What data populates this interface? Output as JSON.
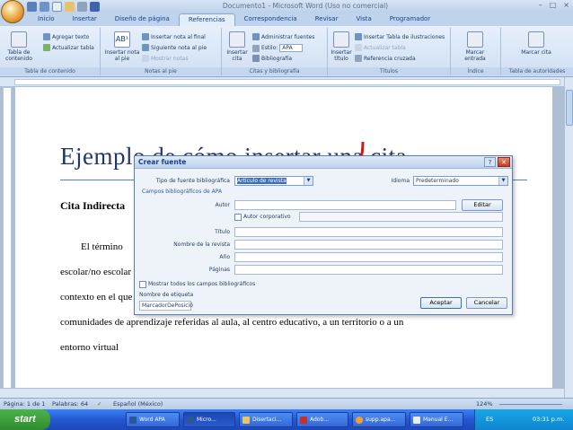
{
  "window": {
    "title": "Documento1 - Microsoft Word (Uso no comercial)",
    "controls": [
      "–",
      "□",
      "×"
    ]
  },
  "tabs": [
    "Inicio",
    "Insertar",
    "Diseño de página",
    "Referencias",
    "Correspondencia",
    "Revisar",
    "Vista",
    "Programador"
  ],
  "ribbon": {
    "toc": {
      "add_text": "Agregar texto",
      "update_table": "Actualizar tabla",
      "big": "Tabla de contenido",
      "group": "Tabla de contenido"
    },
    "footnotes": {
      "insert_endnote": "Insertar nota al final",
      "next_footnote": "Siguiente nota al pie",
      "show_notes": "Mostrar notas",
      "big": "Insertar nota al pie",
      "group": "Notas al pie"
    },
    "citations": {
      "manage_sources": "Administrar fuentes",
      "style_label": "Estilo:",
      "style_value": "APA",
      "bibliography": "Bibliografía",
      "big": "Insertar cita",
      "group": "Citas y bibliografía"
    },
    "captions": {
      "insert_illustrations": "Insertar Tabla de ilustraciones",
      "update_table": "Actualizar tabla",
      "cross_reference": "Referencia cruzada",
      "big": "Insertar título",
      "group": "Títulos"
    },
    "index": {
      "big": "Marcar entrada",
      "group": "Índice"
    },
    "authorities": {
      "big": "Marcar cita",
      "group": "Tabla de autoridades"
    }
  },
  "document": {
    "title": "Ejemplo de cómo insertar una cita",
    "heading": "Cita Indirecta",
    "lines": [
      "El término",
      "escolar/no escolar",
      "contexto en el que",
      "comunidades de aprendizaje referidas al aula, al centro educativo, a un territorio o a un",
      "entorno virtual"
    ]
  },
  "dialog": {
    "title": "Crear fuente",
    "help": "?",
    "close": "✕",
    "source_type_label": "Tipo de fuente bibliográfica",
    "source_type_value": "Artículo de revista",
    "language_label": "Idioma",
    "language_value": "Predeterminado",
    "apa_fields_label": "Campos bibliográficos de APA",
    "author_label": "Autor",
    "edit_button": "Editar",
    "corporate_author_label": "Autor corporativo",
    "fields": [
      "Título",
      "Nombre de la revista",
      "Año",
      "Páginas"
    ],
    "show_all_label": "Mostrar todos los campos bibliográficos",
    "tag_name_label": "Nombre de etiqueta",
    "tag_name_value": "MarcadorDePosició",
    "ok_button": "Aceptar",
    "cancel_button": "Cancelar"
  },
  "statusbar": {
    "page": "Página: 1 de 1",
    "words": "Palabras: 64",
    "language": "Español (México)",
    "zoom": "124%"
  },
  "taskbar": {
    "start": "start",
    "items": [
      "Word APA",
      "Micro...",
      "Disertaci...",
      "Adob...",
      "supp.apa...",
      "Manual E..."
    ],
    "language": "ES",
    "clock": "03:31 p.m."
  },
  "colors": {
    "accent_arrow": "#cc1a1a",
    "title_blue": "#1f3864",
    "ribbon_bg": "#dbe6f4"
  }
}
